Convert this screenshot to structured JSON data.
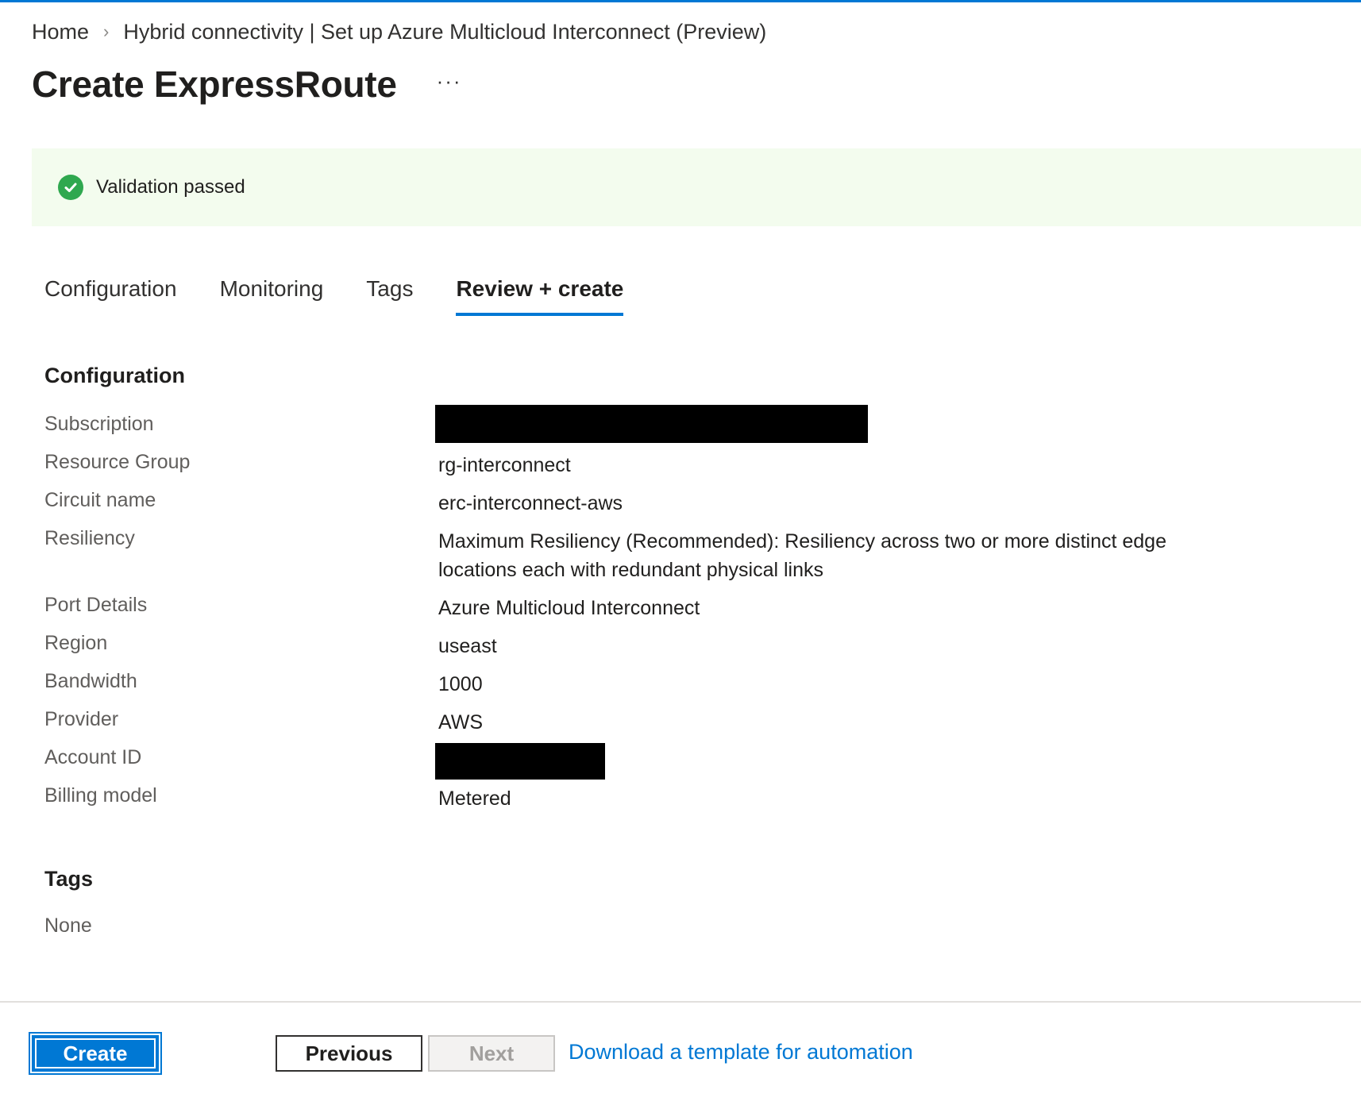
{
  "breadcrumb": {
    "items": [
      "Home",
      "Hybrid connectivity | Set up Azure Multicloud Interconnect (Preview)"
    ],
    "separator": "›"
  },
  "page": {
    "title": "Create ExpressRoute",
    "more_label": "···"
  },
  "validation": {
    "status": "success",
    "text": "Validation passed",
    "color": "#2fa84f"
  },
  "tabs": [
    {
      "label": "Configuration",
      "active": false
    },
    {
      "label": "Monitoring",
      "active": false
    },
    {
      "label": "Tags",
      "active": false
    },
    {
      "label": "Review + create",
      "active": true
    }
  ],
  "review": {
    "configuration_title": "Configuration",
    "rows": [
      {
        "label": "Subscription",
        "value": "",
        "redacted": true
      },
      {
        "label": "Resource Group",
        "value": "rg-interconnect"
      },
      {
        "label": "Circuit name",
        "value": "erc-interconnect-aws"
      },
      {
        "label": "Resiliency",
        "value": "Maximum Resiliency (Recommended): Resiliency across two or more distinct edge locations each with redundant physical links"
      },
      {
        "label": "Port Details",
        "value": "Azure Multicloud Interconnect"
      },
      {
        "label": "Region",
        "value": "useast"
      },
      {
        "label": "Bandwidth",
        "value": "1000"
      },
      {
        "label": "Provider",
        "value": "AWS"
      },
      {
        "label": "Account ID",
        "value": "",
        "redacted": true
      },
      {
        "label": "Billing model",
        "value": "Metered"
      }
    ],
    "tags_title": "Tags",
    "tags_value": "None"
  },
  "footer": {
    "create_label": "Create",
    "previous_label": "Previous",
    "next_label": "Next",
    "next_disabled": true,
    "download_link": "Download a template for automation"
  },
  "colors": {
    "accent": "#0078d4",
    "banner_bg": "#f3fcee"
  }
}
